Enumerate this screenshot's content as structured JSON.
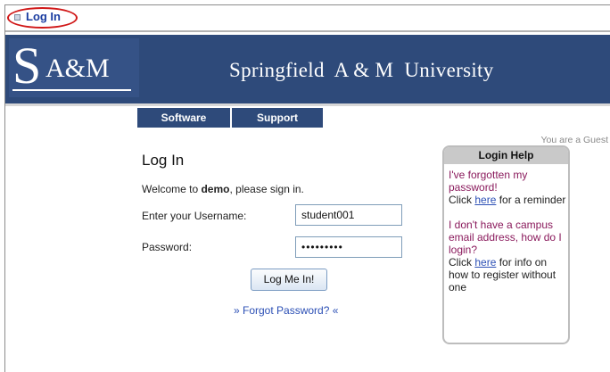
{
  "window": {
    "title": "Log In"
  },
  "banner": {
    "logo_s": "S",
    "logo_am": "A&M",
    "university": "Springfield  A & M  University"
  },
  "nav": {
    "software": "Software",
    "support": "Support"
  },
  "guest_text": "You are a Guest",
  "login": {
    "heading": "Log In",
    "welcome_prefix": "Welcome to ",
    "welcome_site": "demo",
    "welcome_suffix": ", please sign in.",
    "username_label": "Enter your Username:",
    "username_value": "student001",
    "password_label": "Password:",
    "password_value": "•••••••••",
    "submit_label": "Log Me In!",
    "forgot_label": "» Forgot Password? «"
  },
  "help": {
    "title": "Login Help",
    "q1": "I've forgotten my password!",
    "a1_prefix": "Click ",
    "a1_link": "here",
    "a1_suffix": " for a reminder",
    "q2": "I don't have a campus email address, how do I login?",
    "a2_prefix": "Click ",
    "a2_link": "here",
    "a2_suffix": " for info on how to register without one"
  },
  "colors": {
    "banner": "#2e4a7a",
    "link": "#2b4fb5",
    "help_question": "#8a1a5c",
    "highlight_oval": "#d01818"
  }
}
